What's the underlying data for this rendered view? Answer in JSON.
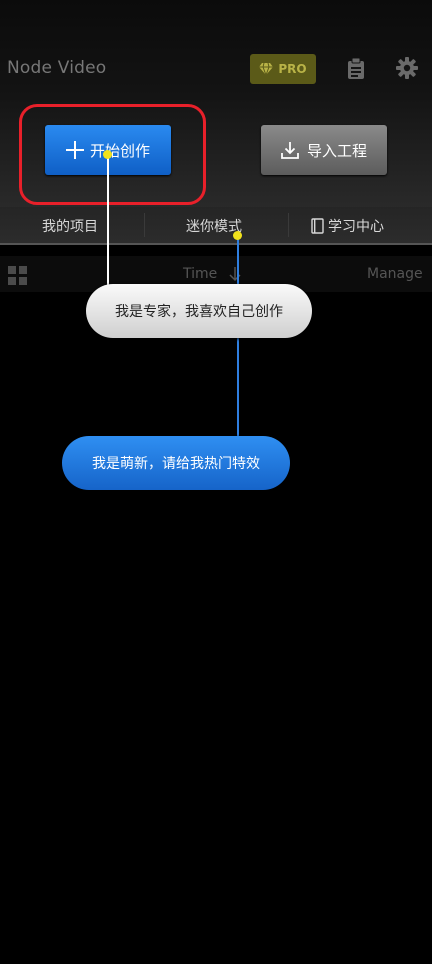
{
  "header": {
    "title": "Node Video",
    "pro_label": "PRO"
  },
  "actions": {
    "start_label": "开始创作",
    "import_label": "导入工程"
  },
  "tabs": [
    {
      "label": "我的项目"
    },
    {
      "label": "迷你模式"
    },
    {
      "label": "学习中心"
    }
  ],
  "list_bar": {
    "sort_label": "Time",
    "manage_label": "Manage"
  },
  "onboarding": {
    "expert_text": "我是专家，我喜欢自己创作",
    "newbie_text": "我是萌新，请给我热门特效"
  },
  "colors": {
    "accent_blue": "#1f77e6",
    "highlight_red": "#e8202a",
    "pro_gold": "#b9b347",
    "pointer_dot": "#f1e21c"
  }
}
